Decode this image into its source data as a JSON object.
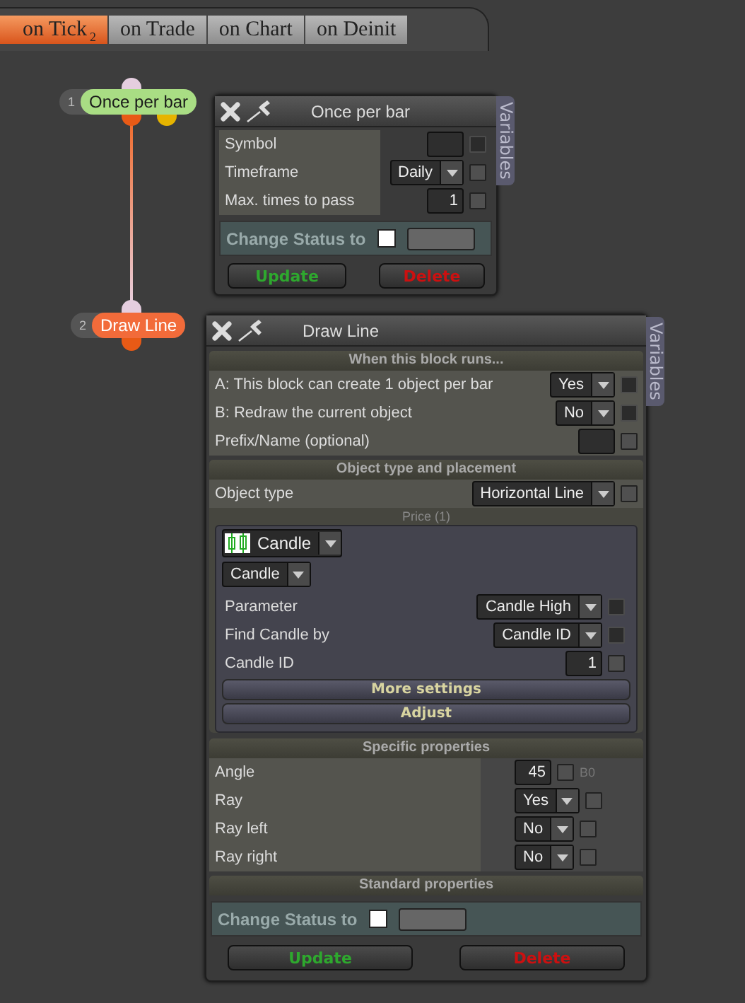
{
  "tabs": [
    {
      "label": "on Tick",
      "count": "2",
      "selected": true
    },
    {
      "label": "on Trade",
      "selected": false
    },
    {
      "label": "on Chart",
      "selected": false
    },
    {
      "label": "on Deinit",
      "selected": false
    }
  ],
  "nodes": [
    {
      "number": "1",
      "label": "Once per bar",
      "color": "#a9dd84"
    },
    {
      "number": "2",
      "label": "Draw Line",
      "color": "#f26b3a"
    }
  ],
  "blocks": [
    {
      "title": "Once per bar",
      "side_tab": "Variables",
      "rows": [
        {
          "kind": "input",
          "label": "Symbol",
          "checked": false,
          "disabled": true
        },
        {
          "kind": "select",
          "label": "Timeframe",
          "value": "Daily",
          "checked": false,
          "disabled": false
        },
        {
          "kind": "input",
          "label": "Max. times to pass",
          "value": "1",
          "checked": false,
          "disabled": false
        }
      ],
      "status": {
        "label": "Change Status to",
        "checked": false
      },
      "buttons": [
        {
          "label": "Update",
          "kind": "update"
        },
        {
          "label": "Delete",
          "kind": "delete"
        }
      ]
    },
    {
      "title": "Draw Line",
      "side_tab": "Variables",
      "sections": [
        {
          "heading": "When this block runs...",
          "rows": [
            {
              "kind": "select",
              "label": "A: This block can create 1 object per bar",
              "value": "Yes",
              "checked": false,
              "disabled": true
            },
            {
              "kind": "select",
              "label": "B: Redraw the current object",
              "value": "No",
              "checked": false,
              "disabled": true
            },
            {
              "kind": "input",
              "label": "Prefix/Name (optional)",
              "checked": false,
              "disabled": false
            }
          ]
        },
        {
          "heading": "Object type and placement",
          "rows": [
            {
              "kind": "select",
              "label": "Object type",
              "value": "Horizontal Line",
              "checked": false,
              "disabled": false
            }
          ],
          "group": {
            "heading": "Price (1)",
            "source": "Candle",
            "source_type": "Candle",
            "rows": [
              {
                "kind": "select",
                "label": "Parameter",
                "value": "Candle High",
                "checked": false,
                "disabled": true
              },
              {
                "kind": "select",
                "label": "Find Candle by",
                "value": "Candle ID",
                "checked": false,
                "disabled": true
              },
              {
                "kind": "input",
                "label": "Candle ID",
                "value": "1",
                "checked": false,
                "disabled": false
              }
            ],
            "buttons": [
              "More settings",
              "Adjust"
            ]
          }
        },
        {
          "heading": "Specific properties",
          "rows": [
            {
              "kind": "input",
              "label": "Angle",
              "value": "45",
              "checked": false,
              "disabled": false,
              "note": "B0"
            },
            {
              "kind": "select",
              "label": "Ray",
              "value": "Yes",
              "checked": false,
              "disabled": false
            },
            {
              "kind": "select",
              "label": "Ray left",
              "value": "No",
              "checked": false,
              "disabled": false
            },
            {
              "kind": "select",
              "label": "Ray right",
              "value": "No",
              "checked": false,
              "disabled": false
            }
          ]
        },
        {
          "heading": "Standard properties"
        }
      ],
      "status": {
        "label": "Change Status to",
        "checked": false
      },
      "buttons": [
        {
          "label": "Update",
          "kind": "update"
        },
        {
          "label": "Delete",
          "kind": "delete"
        }
      ]
    }
  ]
}
